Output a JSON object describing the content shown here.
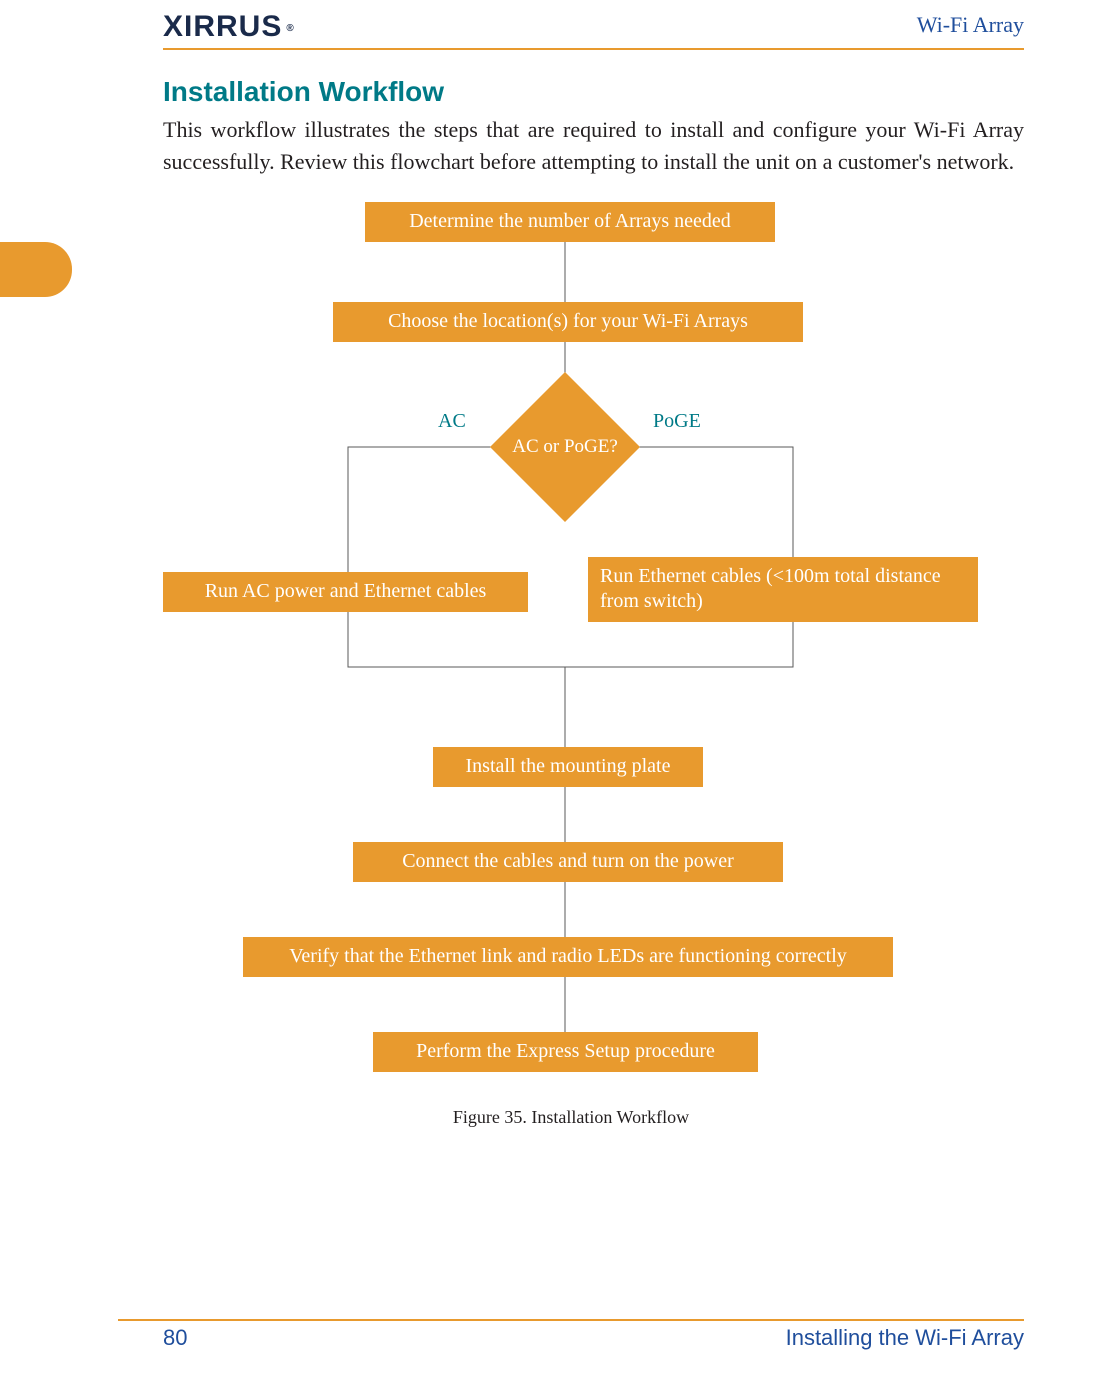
{
  "header": {
    "brand": "XIRRUS",
    "product": "Wi-Fi Array"
  },
  "section": {
    "title": "Installation Workflow",
    "intro": "This workflow illustrates the steps that are required to install and configure your Wi-Fi Array successfully. Review this flowchart before attempting to install the unit on a customer's network."
  },
  "chart_data": {
    "type": "flowchart",
    "nodes": [
      {
        "id": "n1",
        "kind": "process",
        "label": "Determine the number of Arrays needed"
      },
      {
        "id": "n2",
        "kind": "process",
        "label": "Choose the location(s) for your Wi-Fi Arrays"
      },
      {
        "id": "d1",
        "kind": "decision",
        "label": "AC or PoGE?",
        "left_label": "AC",
        "right_label": "PoGE"
      },
      {
        "id": "n3",
        "kind": "process",
        "label": "Run AC power and Ethernet cables"
      },
      {
        "id": "n4",
        "kind": "process",
        "label": "Run Ethernet cables (<100m total distance from switch)"
      },
      {
        "id": "n5",
        "kind": "process",
        "label": "Install the mounting plate"
      },
      {
        "id": "n6",
        "kind": "process",
        "label": "Connect the cables and turn on the power"
      },
      {
        "id": "n7",
        "kind": "process",
        "label": "Verify that the Ethernet link and radio LEDs are functioning correctly"
      },
      {
        "id": "n8",
        "kind": "process",
        "label": "Perform the Express Setup procedure"
      }
    ],
    "edges": [
      {
        "from": "n1",
        "to": "n2"
      },
      {
        "from": "n2",
        "to": "d1"
      },
      {
        "from": "d1",
        "to": "n3",
        "label": "AC"
      },
      {
        "from": "d1",
        "to": "n4",
        "label": "PoGE"
      },
      {
        "from": "n3",
        "to": "n5"
      },
      {
        "from": "n4",
        "to": "n5"
      },
      {
        "from": "n5",
        "to": "n6"
      },
      {
        "from": "n6",
        "to": "n7"
      },
      {
        "from": "n7",
        "to": "n8"
      }
    ]
  },
  "figure": {
    "caption": "Figure 35. Installation Workflow"
  },
  "footer": {
    "page": "80",
    "section_title": "Installing the Wi-Fi Array"
  }
}
